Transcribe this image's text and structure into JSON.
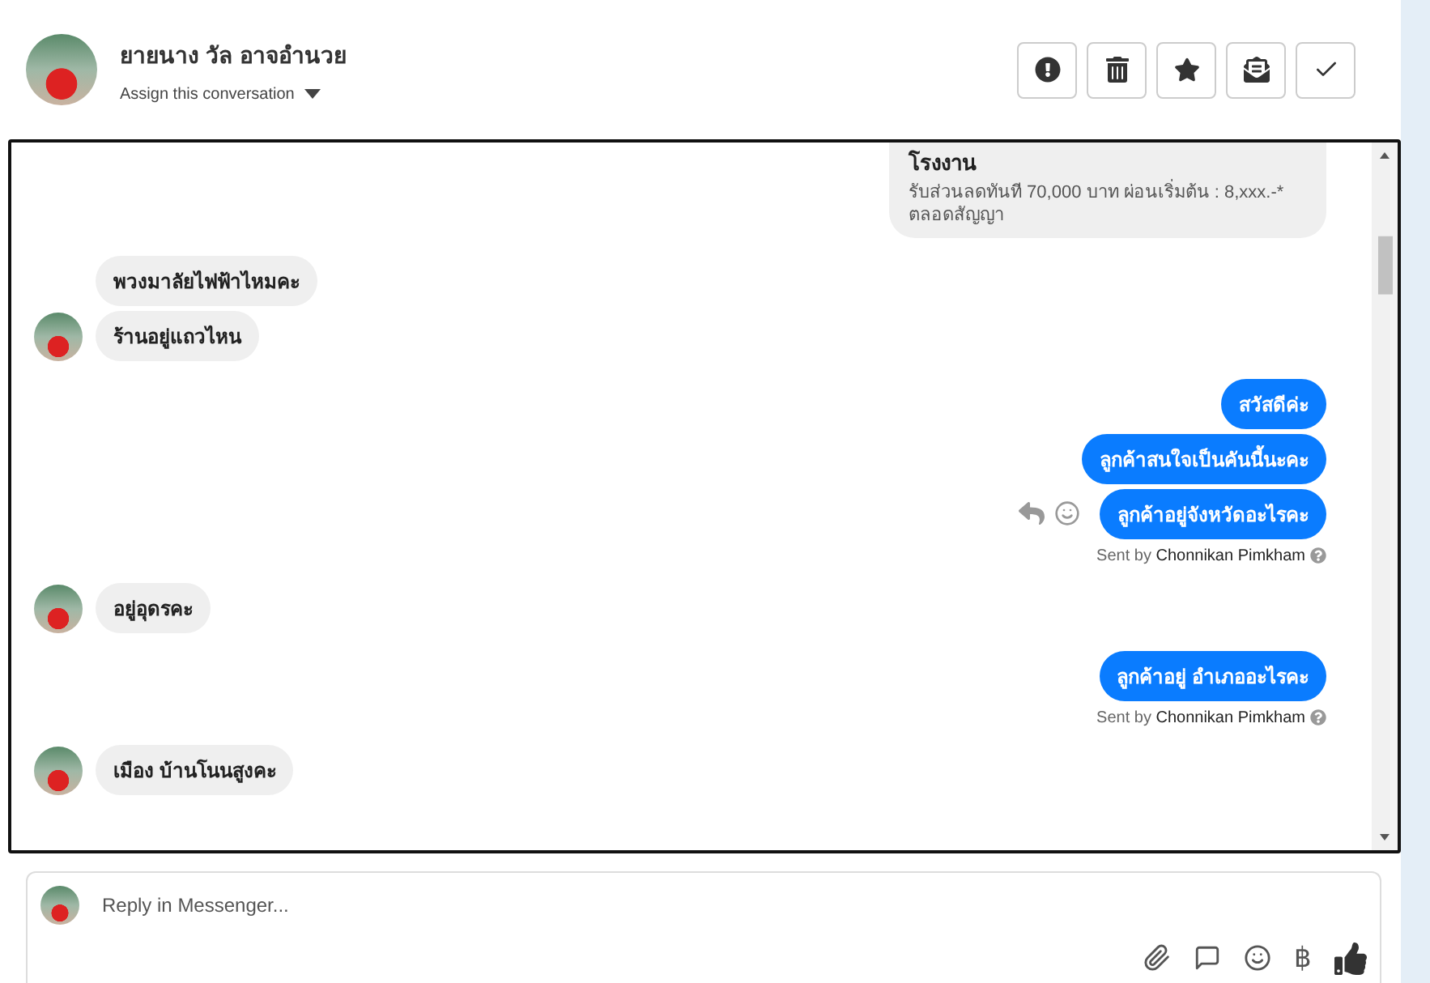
{
  "header": {
    "name": "ยายนาง วัล อาจอำนวย",
    "assign": "Assign this conversation",
    "actions": [
      {
        "kind": "alert"
      },
      {
        "kind": "trash"
      },
      {
        "kind": "star"
      },
      {
        "kind": "envelope"
      },
      {
        "kind": "check"
      }
    ]
  },
  "clusters": [
    {
      "kind": "outgoing",
      "card": {
        "title": "โรงงาน",
        "text": "รับส่วนลดทันที 70,000 บาท ผ่อนเริ่มต้น : 8,xxx.-* ตลอดสัญญา"
      }
    },
    {
      "kind": "incoming",
      "messages": [
        "พวงมาลัยไฟฟ้าไหมคะ",
        "ร้านอยู่แถวไหน"
      ]
    },
    {
      "kind": "outgoing",
      "messages": [
        "สวัสดีค่ะ",
        "ลูกค้าสนใจเป็นคันนี้นะคะ",
        "ลูกค้าอยู่จังหวัดอะไรคะ"
      ],
      "hover_actions": true,
      "sent_by": {
        "label": "Sent by",
        "name": "Chonnikan Pimkham"
      }
    },
    {
      "kind": "incoming",
      "messages": [
        "อยู่อุดรคะ"
      ]
    },
    {
      "kind": "outgoing",
      "messages": [
        "ลูกค้าอยู่ อำเภออะไรคะ"
      ],
      "hover_actions": false,
      "sent_by": {
        "label": "Sent by",
        "name": "Chonnikan Pimkham"
      }
    },
    {
      "kind": "incoming",
      "messages": [
        "เมือง   บ้านโนนสูงคะ"
      ]
    }
  ],
  "composer": {
    "placeholder": "Reply in Messenger...",
    "tools": [
      {
        "kind": "attach"
      },
      {
        "kind": "chat"
      },
      {
        "kind": "emoji"
      },
      {
        "kind": "text",
        "label": "฿"
      },
      {
        "kind": "like"
      }
    ]
  }
}
